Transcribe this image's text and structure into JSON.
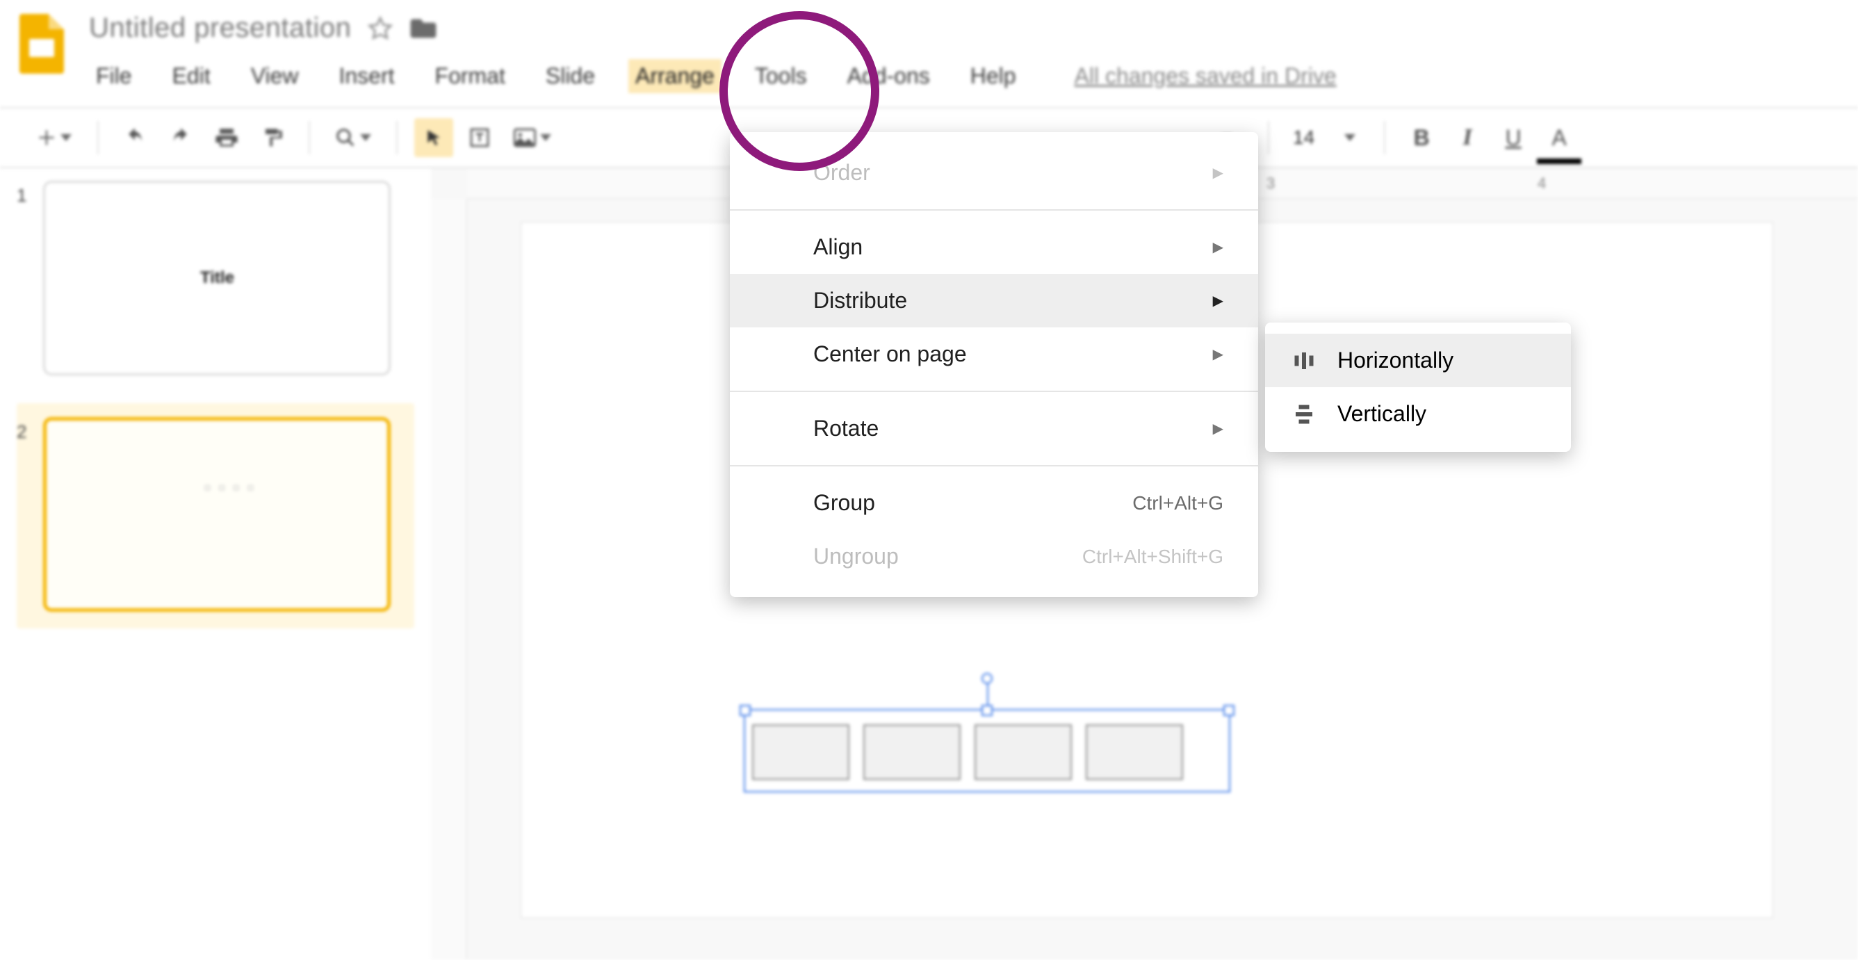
{
  "header": {
    "title": "Untitled presentation",
    "saved_status": "All changes saved in Drive"
  },
  "menubar": {
    "items": [
      "File",
      "Edit",
      "View",
      "Insert",
      "Format",
      "Slide",
      "Arrange",
      "Tools",
      "Add-ons",
      "Help"
    ],
    "active": "Arrange"
  },
  "toolbar": {
    "font_size": "14",
    "format": {
      "bold": "B",
      "italic": "I",
      "underline": "U",
      "text_color": "A"
    }
  },
  "slides": {
    "list": [
      {
        "num": "1",
        "label": "Title",
        "selected": false
      },
      {
        "num": "2",
        "label": "",
        "selected": true
      }
    ]
  },
  "ruler": {
    "ticks": [
      {
        "pos": 1150,
        "label": "3"
      },
      {
        "pos": 1540,
        "label": "4"
      }
    ]
  },
  "arrange_menu": {
    "items": [
      {
        "label": "Order",
        "type": "submenu",
        "disabled": true
      },
      {
        "type": "sep"
      },
      {
        "label": "Align",
        "type": "submenu",
        "disabled": false
      },
      {
        "label": "Distribute",
        "type": "submenu",
        "disabled": false,
        "hover": true
      },
      {
        "label": "Center on page",
        "type": "submenu",
        "disabled": false
      },
      {
        "type": "sep"
      },
      {
        "label": "Rotate",
        "type": "submenu",
        "disabled": false
      },
      {
        "type": "sep"
      },
      {
        "label": "Group",
        "type": "cmd",
        "shortcut": "Ctrl+Alt+G",
        "disabled": false
      },
      {
        "label": "Ungroup",
        "type": "cmd",
        "shortcut": "Ctrl+Alt+Shift+G",
        "disabled": true
      }
    ]
  },
  "distribute_submenu": {
    "items": [
      {
        "label": "Horizontally",
        "hover": true,
        "icon": "dist-h"
      },
      {
        "label": "Vertically",
        "hover": false,
        "icon": "dist-v"
      }
    ]
  }
}
